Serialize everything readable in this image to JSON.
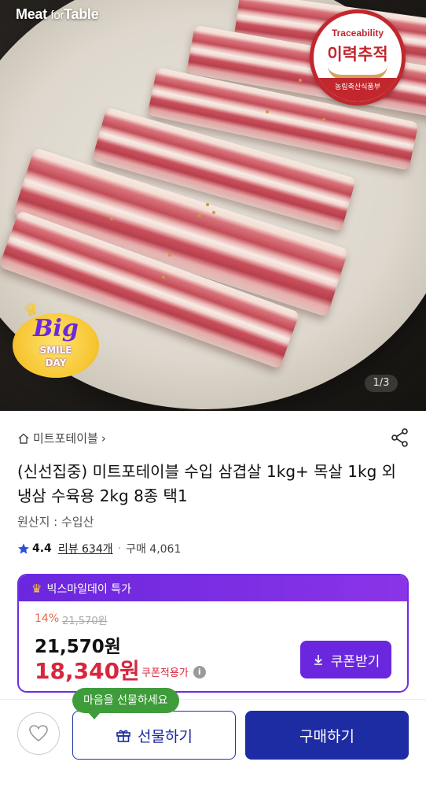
{
  "hero": {
    "logo_main": "Meat",
    "logo_small": "for",
    "logo_end": "Table",
    "trace_en": "Traceability",
    "trace_ko": "이력추적",
    "trace_org": "농림축산식품부",
    "promo_line1": "Big",
    "promo_line2": "SMILE",
    "promo_line3": "DAY",
    "counter": "1/3"
  },
  "product": {
    "brand": "미트포테이블",
    "brand_chevron": "›",
    "title": "(신선집중) 미트포테이블 수입 삼겹살 1kg+ 목살 1kg 외 냉삼 수육용 2kg 8종 택1",
    "origin": "원산지 : 수입산",
    "rating": "4.4",
    "reviews": "리뷰 634개",
    "purchases": "구매 4,061"
  },
  "deal": {
    "label": "빅스마일데이 특가",
    "discount_pct": "14%",
    "original_price": "21,570원",
    "price": "21,570원",
    "coupon_price": "18,340원",
    "coupon_label": "쿠폰적용가",
    "coupon_button": "쿠폰받기"
  },
  "bottom": {
    "tooltip": "마음을 선물하세요",
    "gift_button": "선물하기",
    "buy_button": "구매하기"
  },
  "colors": {
    "accent_purple": "#6a27dd",
    "price_red": "#d7263d",
    "buy_blue": "#1e2ca4",
    "tooltip_green": "#3f9c3a"
  }
}
